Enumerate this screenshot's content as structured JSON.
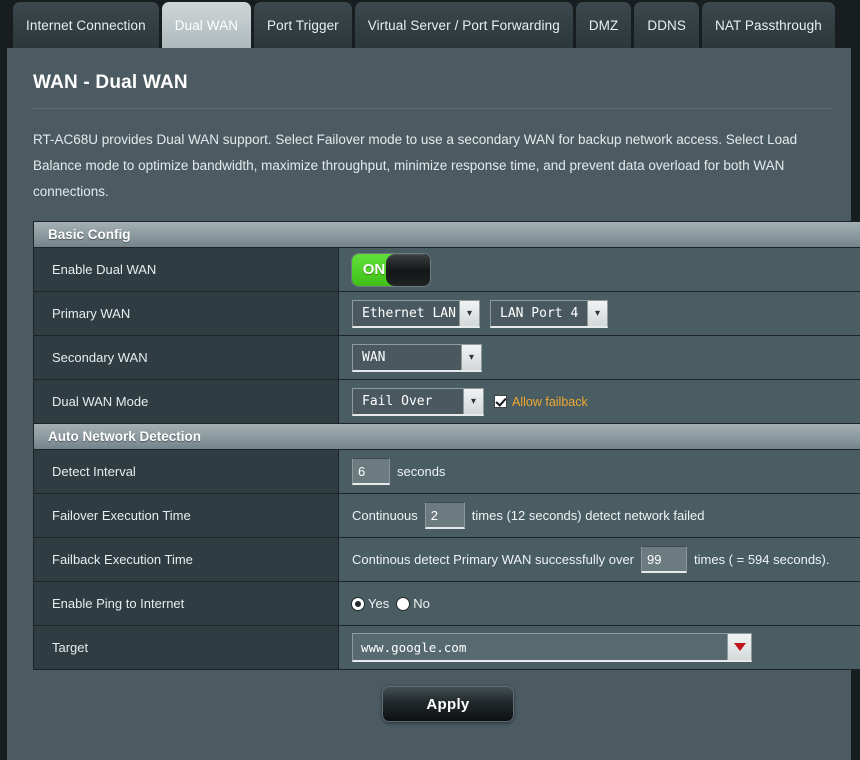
{
  "tabs": [
    {
      "label": "Internet Connection",
      "active": false
    },
    {
      "label": "Dual WAN",
      "active": true
    },
    {
      "label": "Port Trigger",
      "active": false
    },
    {
      "label": "Virtual Server / Port Forwarding",
      "active": false
    },
    {
      "label": "DMZ",
      "active": false
    },
    {
      "label": "DDNS",
      "active": false
    },
    {
      "label": "NAT Passthrough",
      "active": false
    }
  ],
  "page": {
    "title": "WAN - Dual WAN",
    "description": "RT-AC68U provides Dual WAN support. Select Failover mode to use a secondary WAN for backup network access. Select Load Balance mode to optimize bandwidth, maximize throughput, minimize response time, and prevent data overload for both WAN connections."
  },
  "basic_config": {
    "section_title": "Basic Config",
    "enable_dual_wan": {
      "label": "Enable Dual WAN",
      "toggle_state": "ON"
    },
    "primary_wan": {
      "label": "Primary WAN",
      "type_value": "Ethernet LAN",
      "port_value": "LAN Port 4"
    },
    "secondary_wan": {
      "label": "Secondary WAN",
      "value": "WAN"
    },
    "dual_wan_mode": {
      "label": "Dual WAN Mode",
      "value": "Fail Over",
      "failback_label": "Allow failback",
      "failback_checked": true
    }
  },
  "auto_detection": {
    "section_title": "Auto Network Detection",
    "detect_interval": {
      "label": "Detect Interval",
      "value": "6",
      "unit": "seconds"
    },
    "failover_execution_time": {
      "label": "Failover Execution Time",
      "prefix": "Continuous",
      "value": "2",
      "suffix": "times (12  seconds) detect network failed"
    },
    "failback_execution_time": {
      "label": "Failback Execution Time",
      "prefix": "Continous detect Primary WAN successfully over",
      "value": "99",
      "suffix": "times ( = 594  seconds)."
    },
    "enable_ping": {
      "label": "Enable Ping to Internet",
      "yes_label": "Yes",
      "no_label": "No",
      "selected": "Yes"
    },
    "target": {
      "label": "Target",
      "value": "www.google.com"
    }
  },
  "apply_button": "Apply",
  "colors": {
    "accent_green": "#3fbf17",
    "accent_orange": "#f0a830",
    "accent_red": "#c0131b",
    "panel_bg": "#4b5b61",
    "label_bg": "#2f3c42",
    "value_bg": "#495d63"
  }
}
